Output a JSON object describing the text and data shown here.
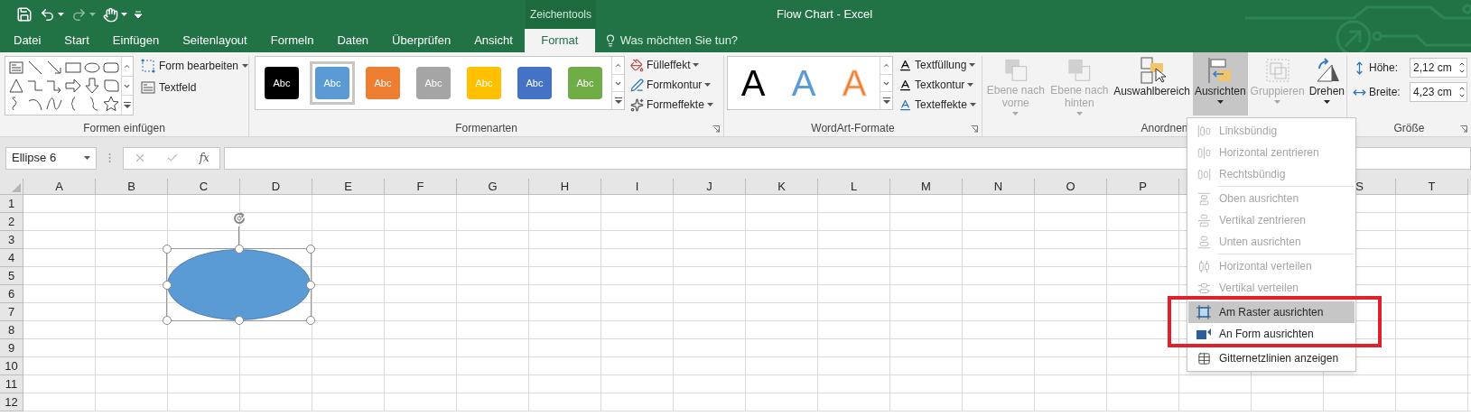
{
  "title_bar": {
    "title": "Flow Chart - Excel",
    "contextual_header": "Zeichentools"
  },
  "tabs": [
    {
      "label": "Datei",
      "selected": false
    },
    {
      "label": "Start",
      "selected": false
    },
    {
      "label": "Einfügen",
      "selected": false
    },
    {
      "label": "Seitenlayout",
      "selected": false
    },
    {
      "label": "Formeln",
      "selected": false
    },
    {
      "label": "Daten",
      "selected": false
    },
    {
      "label": "Überprüfen",
      "selected": false
    },
    {
      "label": "Ansicht",
      "selected": false
    },
    {
      "label": "Format",
      "selected": true
    }
  ],
  "tell_me": {
    "placeholder": "Was möchten Sie tun?"
  },
  "shapes_group": {
    "label": "Formen einfügen",
    "commands": [
      {
        "label": "Form bearbeiten",
        "dropdown": true
      },
      {
        "label": "Textfeld",
        "dropdown": false
      }
    ]
  },
  "styles_group": {
    "label": "Formenarten",
    "swatches": [
      {
        "text": "Abc",
        "color": "#000000",
        "selected": false
      },
      {
        "text": "Abc",
        "color": "#5b9bd5",
        "selected": true
      },
      {
        "text": "Abc",
        "color": "#ed7d31",
        "selected": false
      },
      {
        "text": "Abc",
        "color": "#a5a5a5",
        "selected": false
      },
      {
        "text": "Abc",
        "color": "#ffc000",
        "selected": false
      },
      {
        "text": "Abc",
        "color": "#4472c4",
        "selected": false
      },
      {
        "text": "Abc",
        "color": "#70ad47",
        "selected": false
      }
    ],
    "commands": [
      "Fülleffekt",
      "Formkontur",
      "Formeffekte"
    ]
  },
  "wordart_group": {
    "label": "WordArt-Formate",
    "samples": [
      {
        "text": "A",
        "color": "#000000",
        "kind": "solid"
      },
      {
        "text": "A",
        "color": "#5b9bd5",
        "kind": "solid"
      },
      {
        "text": "A",
        "color": "#ed7d31",
        "kind": "outline"
      }
    ],
    "commands": [
      "Textfüllung",
      "Textkontur",
      "Texteffekte"
    ]
  },
  "arrange_group": {
    "label": "Anordnen",
    "buttons": [
      {
        "label": "Ebene nach vorne",
        "disabled": true,
        "pressed": false,
        "dropdown": true
      },
      {
        "label": "Ebene nach hinten",
        "disabled": true,
        "pressed": false,
        "dropdown": true
      },
      {
        "label": "Auswahlbereich",
        "disabled": false,
        "pressed": false,
        "dropdown": false
      },
      {
        "label": "Ausrichten",
        "disabled": false,
        "pressed": true,
        "dropdown": true
      },
      {
        "label": "Gruppieren",
        "disabled": true,
        "pressed": false,
        "dropdown": true
      },
      {
        "label": "Drehen",
        "disabled": false,
        "pressed": false,
        "dropdown": true
      }
    ]
  },
  "size_group": {
    "label": "Größe",
    "fields": [
      {
        "label": "Höhe:",
        "value": "2,12 cm"
      },
      {
        "label": "Breite:",
        "value": "4,23 cm"
      }
    ]
  },
  "formula_bar": {
    "name_box": "Ellipse 6",
    "function_label": "fx"
  },
  "sheet": {
    "columns_left": [
      "A",
      "B",
      "C",
      "D",
      "E",
      "F",
      "G",
      "H",
      "I",
      "J",
      "K",
      "L",
      "M",
      "N",
      "O",
      "P"
    ],
    "columns_right": [
      "S",
      "T"
    ],
    "rows": [
      "1",
      "2",
      "3",
      "4",
      "5",
      "6",
      "7",
      "8",
      "9",
      "10",
      "11",
      "12"
    ]
  },
  "menu": {
    "items": [
      {
        "kind": "item",
        "label": "Linksbündig",
        "disabled": true,
        "selected": false
      },
      {
        "kind": "item",
        "label": "Horizontal zentrieren",
        "disabled": true,
        "selected": false
      },
      {
        "kind": "item",
        "label": "Rechtsbündig",
        "disabled": true,
        "selected": false
      },
      {
        "kind": "separator"
      },
      {
        "kind": "item",
        "label": "Oben ausrichten",
        "disabled": true,
        "selected": false
      },
      {
        "kind": "item",
        "label": "Vertikal zentrieren",
        "disabled": true,
        "selected": false
      },
      {
        "kind": "item",
        "label": "Unten ausrichten",
        "disabled": true,
        "selected": false
      },
      {
        "kind": "separator"
      },
      {
        "kind": "item",
        "label": "Horizontal verteilen",
        "disabled": true,
        "selected": false
      },
      {
        "kind": "item",
        "label": "Vertikal verteilen",
        "disabled": true,
        "selected": false
      },
      {
        "kind": "separator"
      },
      {
        "kind": "item",
        "label": "Am Raster ausrichten",
        "disabled": false,
        "selected": true
      },
      {
        "kind": "item",
        "label": "An Form ausrichten",
        "disabled": false,
        "selected": false
      },
      {
        "kind": "separator"
      },
      {
        "kind": "item",
        "label": "Gitternetzlinien anzeigen",
        "disabled": false,
        "selected": false
      }
    ]
  }
}
